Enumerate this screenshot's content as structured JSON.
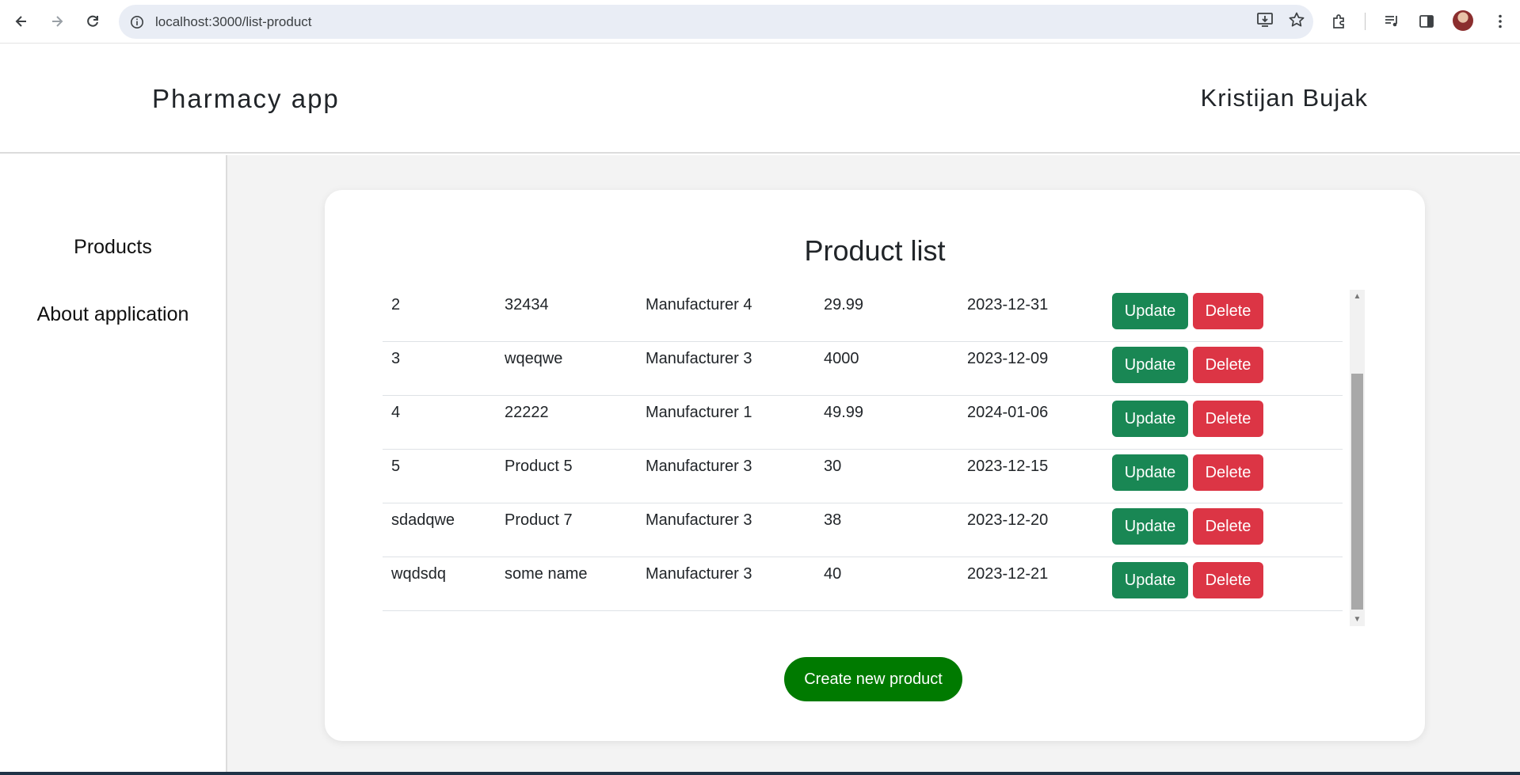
{
  "browser": {
    "url": "localhost:3000/list-product"
  },
  "app": {
    "brand": "Pharmacy app",
    "user_name": "Kristijan Bujak"
  },
  "sidebar": {
    "items": [
      {
        "label": "Products"
      },
      {
        "label": "About application"
      }
    ]
  },
  "main": {
    "title": "Product list",
    "rows": [
      {
        "code": "2",
        "name": "32434",
        "manufacturer": "Manufacturer 4",
        "price": "29.99",
        "date": "2023-12-31",
        "update_label": "Update",
        "delete_label": "Delete"
      },
      {
        "code": "3",
        "name": "wqeqwe",
        "manufacturer": "Manufacturer 3",
        "price": "4000",
        "date": "2023-12-09",
        "update_label": "Update",
        "delete_label": "Delete"
      },
      {
        "code": "4",
        "name": "22222",
        "manufacturer": "Manufacturer 1",
        "price": "49.99",
        "date": "2024-01-06",
        "update_label": "Update",
        "delete_label": "Delete"
      },
      {
        "code": "5",
        "name": "Product 5",
        "manufacturer": "Manufacturer 3",
        "price": "30",
        "date": "2023-12-15",
        "update_label": "Update",
        "delete_label": "Delete"
      },
      {
        "code": "sdadqwe",
        "name": "Product 7",
        "manufacturer": "Manufacturer 3",
        "price": "38",
        "date": "2023-12-20",
        "update_label": "Update",
        "delete_label": "Delete"
      },
      {
        "code": "wqdsdq",
        "name": "some name",
        "manufacturer": "Manufacturer 3",
        "price": "40",
        "date": "2023-12-21",
        "update_label": "Update",
        "delete_label": "Delete"
      }
    ],
    "create_label": "Create new product"
  },
  "colors": {
    "update": "#198754",
    "delete": "#dc3545",
    "create": "#007a00"
  }
}
